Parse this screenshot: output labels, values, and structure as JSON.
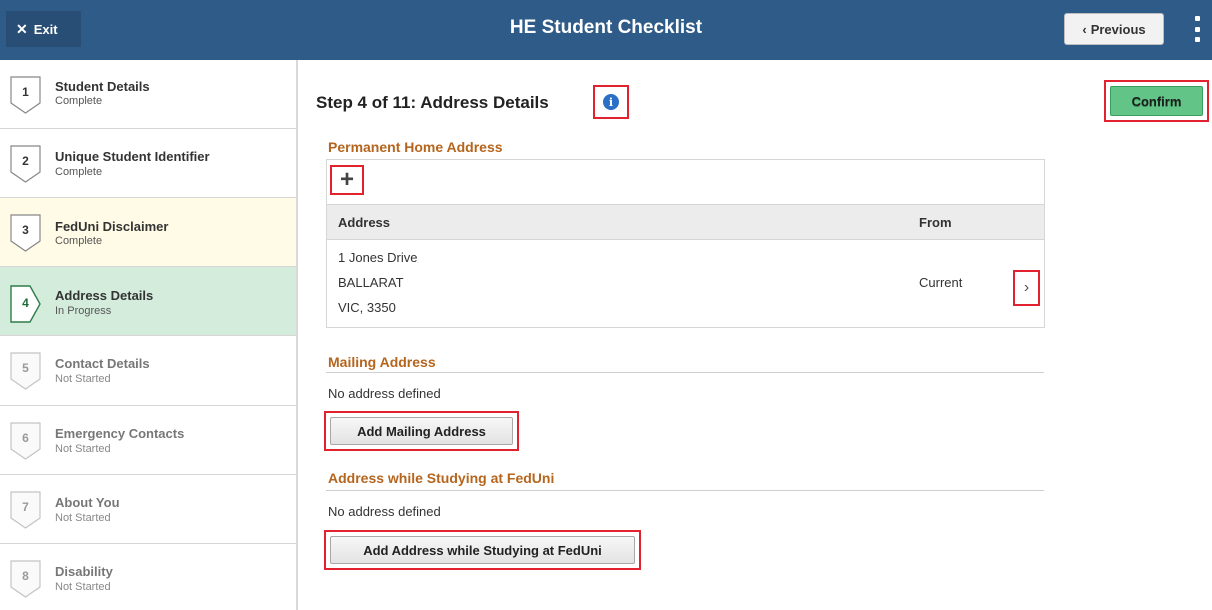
{
  "header": {
    "exit_label": "Exit",
    "title": "HE Student Checklist",
    "previous_label": "Previous"
  },
  "steps": [
    {
      "num": "1",
      "name": "Student Details",
      "status": "Complete"
    },
    {
      "num": "2",
      "name": "Unique Student Identifier",
      "status": "Complete"
    },
    {
      "num": "3",
      "name": "FedUni Disclaimer",
      "status": "Complete"
    },
    {
      "num": "4",
      "name": "Address Details",
      "status": "In Progress"
    },
    {
      "num": "5",
      "name": "Contact Details",
      "status": "Not Started"
    },
    {
      "num": "6",
      "name": "Emergency Contacts",
      "status": "Not Started"
    },
    {
      "num": "7",
      "name": "About You",
      "status": "Not Started"
    },
    {
      "num": "8",
      "name": "Disability",
      "status": "Not Started"
    }
  ],
  "main": {
    "title": "Step 4 of 11: Address Details",
    "confirm_label": "Confirm",
    "permanent": {
      "title": "Permanent Home Address",
      "col_address": "Address",
      "col_from": "From",
      "address_line1": "1 Jones Drive",
      "address_line2": "BALLARAT",
      "address_line3": "VIC, 3350",
      "from_value": "Current"
    },
    "mailing": {
      "title": "Mailing Address",
      "empty_text": "No address defined",
      "button_label": "Add Mailing Address"
    },
    "studying": {
      "title": "Address while Studying at FedUni",
      "empty_text": "No address defined",
      "button_label": "Add Address while Studying at FedUni"
    }
  },
  "colors": {
    "header": "#2f5b89",
    "section_title": "#b5651d",
    "confirm": "#62c587",
    "highlight": "#e2222f",
    "active_step": "#d4ecdc",
    "disclaimer_step": "#fffbe6"
  }
}
